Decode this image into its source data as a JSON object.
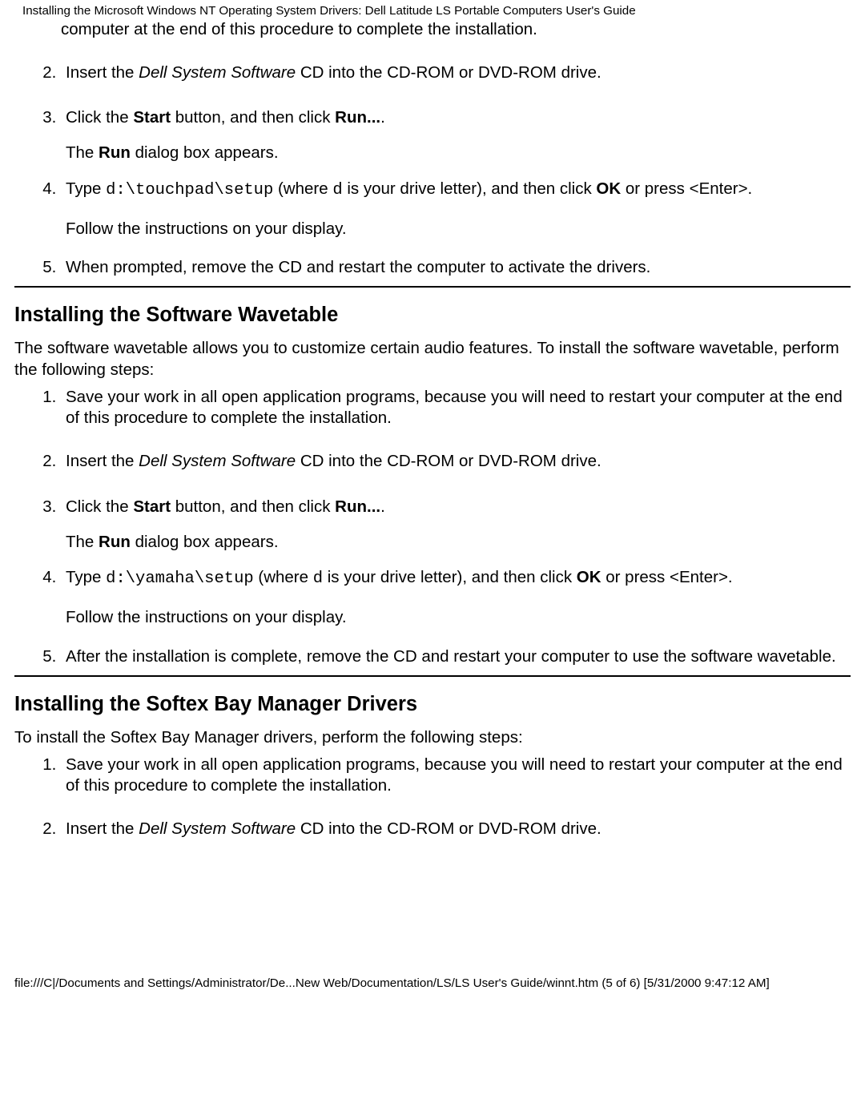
{
  "header": "Installing the Microsoft Windows NT Operating System Drivers:  Dell Latitude LS Portable Computers User's Guide",
  "sectionA": {
    "step1_trail": "computer at the end of this procedure to complete the installation.",
    "step2_a": "Insert the ",
    "step2_cd": "Dell System Software",
    "step2_b": " CD into the CD-ROM or DVD-ROM drive.",
    "step3_a": "Click the ",
    "step3_start": "Start",
    "step3_b": " button, and then click ",
    "step3_run": "Run...",
    "step3_c": ".",
    "step3_p2_a": "The ",
    "step3_p2_run": "Run",
    "step3_p2_b": " dialog box appears.",
    "step4_a": "Type ",
    "step4_cmd": "d:\\touchpad\\setup",
    "step4_b": " (where ",
    "step4_d": "d",
    "step4_c": " is your drive letter), and then click ",
    "step4_ok": "OK",
    "step4_e": " or press <Enter>.",
    "step4_p2": "Follow the instructions on your display.",
    "step5": "When prompted, remove the CD and restart the computer to activate the drivers."
  },
  "sectionB": {
    "heading": "Installing the Software Wavetable",
    "intro": "The software wavetable allows you to customize certain audio features. To install the software wavetable, perform the following steps:",
    "step1": "Save your work in all open application programs, because you will need to restart your computer at the end of this procedure to complete the installation.",
    "step2_a": "Insert the ",
    "step2_cd": "Dell System Software",
    "step2_b": " CD into the CD-ROM or DVD-ROM drive.",
    "step3_a": "Click the ",
    "step3_start": "Start",
    "step3_b": " button, and then click ",
    "step3_run": "Run...",
    "step3_c": ".",
    "step3_p2_a": "The ",
    "step3_p2_run": "Run",
    "step3_p2_b": " dialog box appears.",
    "step4_a": "Type ",
    "step4_cmd": "d:\\yamaha\\setup",
    "step4_b": " (where ",
    "step4_d": "d",
    "step4_c": " is your drive letter), and then click ",
    "step4_ok": "OK",
    "step4_e": " or press <Enter>.",
    "step4_p2": "Follow the instructions on your display.",
    "step5": "After the installation is complete, remove the CD and restart your computer to use the software wavetable."
  },
  "sectionC": {
    "heading": "Installing the Softex Bay Manager Drivers",
    "intro": "To install the Softex Bay Manager drivers, perform the following steps:",
    "step1": "Save your work in all open application programs, because you will need to restart your computer at the end of this procedure to complete the installation.",
    "step2_a": "Insert the ",
    "step2_cd": "Dell System Software",
    "step2_b": " CD into the CD-ROM or DVD-ROM drive."
  },
  "footer": "file:///C|/Documents and Settings/Administrator/De...New Web/Documentation/LS/LS User's Guide/winnt.htm (5 of 6) [5/31/2000 9:47:12 AM]"
}
